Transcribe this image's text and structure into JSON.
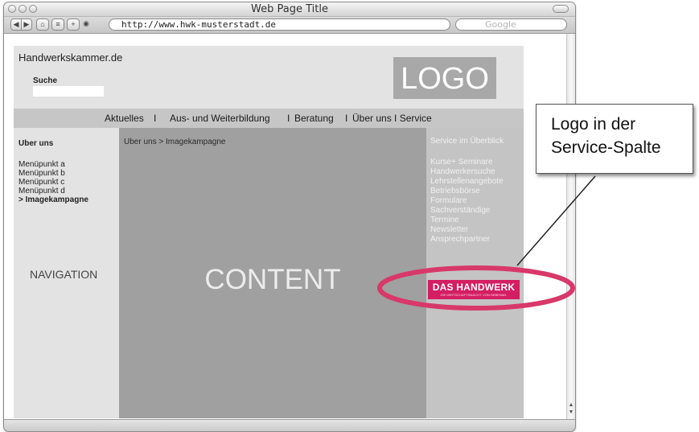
{
  "browser": {
    "window_title": "Web Page Title",
    "url": "http://www.hwk-musterstadt.de",
    "search_placeholder": "Google"
  },
  "page": {
    "site_name": "Handwerkskammer.de",
    "search_label": "Suche",
    "logo_placeholder": "LOGO",
    "top_nav": {
      "aktuelles": "Aktuelles",
      "aus_weiterbildung": "Aus- und Weiterbildung",
      "beratung": "Beratung",
      "ueber_uns_service": "Über uns I Service",
      "separator": "I"
    },
    "left_nav": {
      "title": "Uber uns",
      "items": [
        "Menüpunkt a",
        "Menüpunkt b",
        "Menüpunkt c",
        "Menüpunkt d",
        "> Imagekampagne"
      ],
      "placeholder": "NAVIGATION"
    },
    "content": {
      "breadcrumb": "Uber uns > Imagekampagne",
      "placeholder": "CONTENT"
    },
    "service": {
      "heading": "Service im Überblick",
      "items": [
        "Kurse+ Seminare",
        "Handwerkersuche",
        "Lehrstellenangebote",
        "Betriebsbörse",
        "Formulare",
        "Sachverständige",
        "Termine",
        "Newsletter",
        "Ansprechpartner"
      ],
      "brand_logo_text": "DAS HANDWERK",
      "brand_logo_sub": "DIE WIRTSCHAFTSMACHT. VON NEBENAN.",
      "brand_color": "#d41e62"
    }
  },
  "annotation": {
    "line1": "Logo in der",
    "line2": "Service-Spalte",
    "highlight_color": "#d8386a"
  }
}
